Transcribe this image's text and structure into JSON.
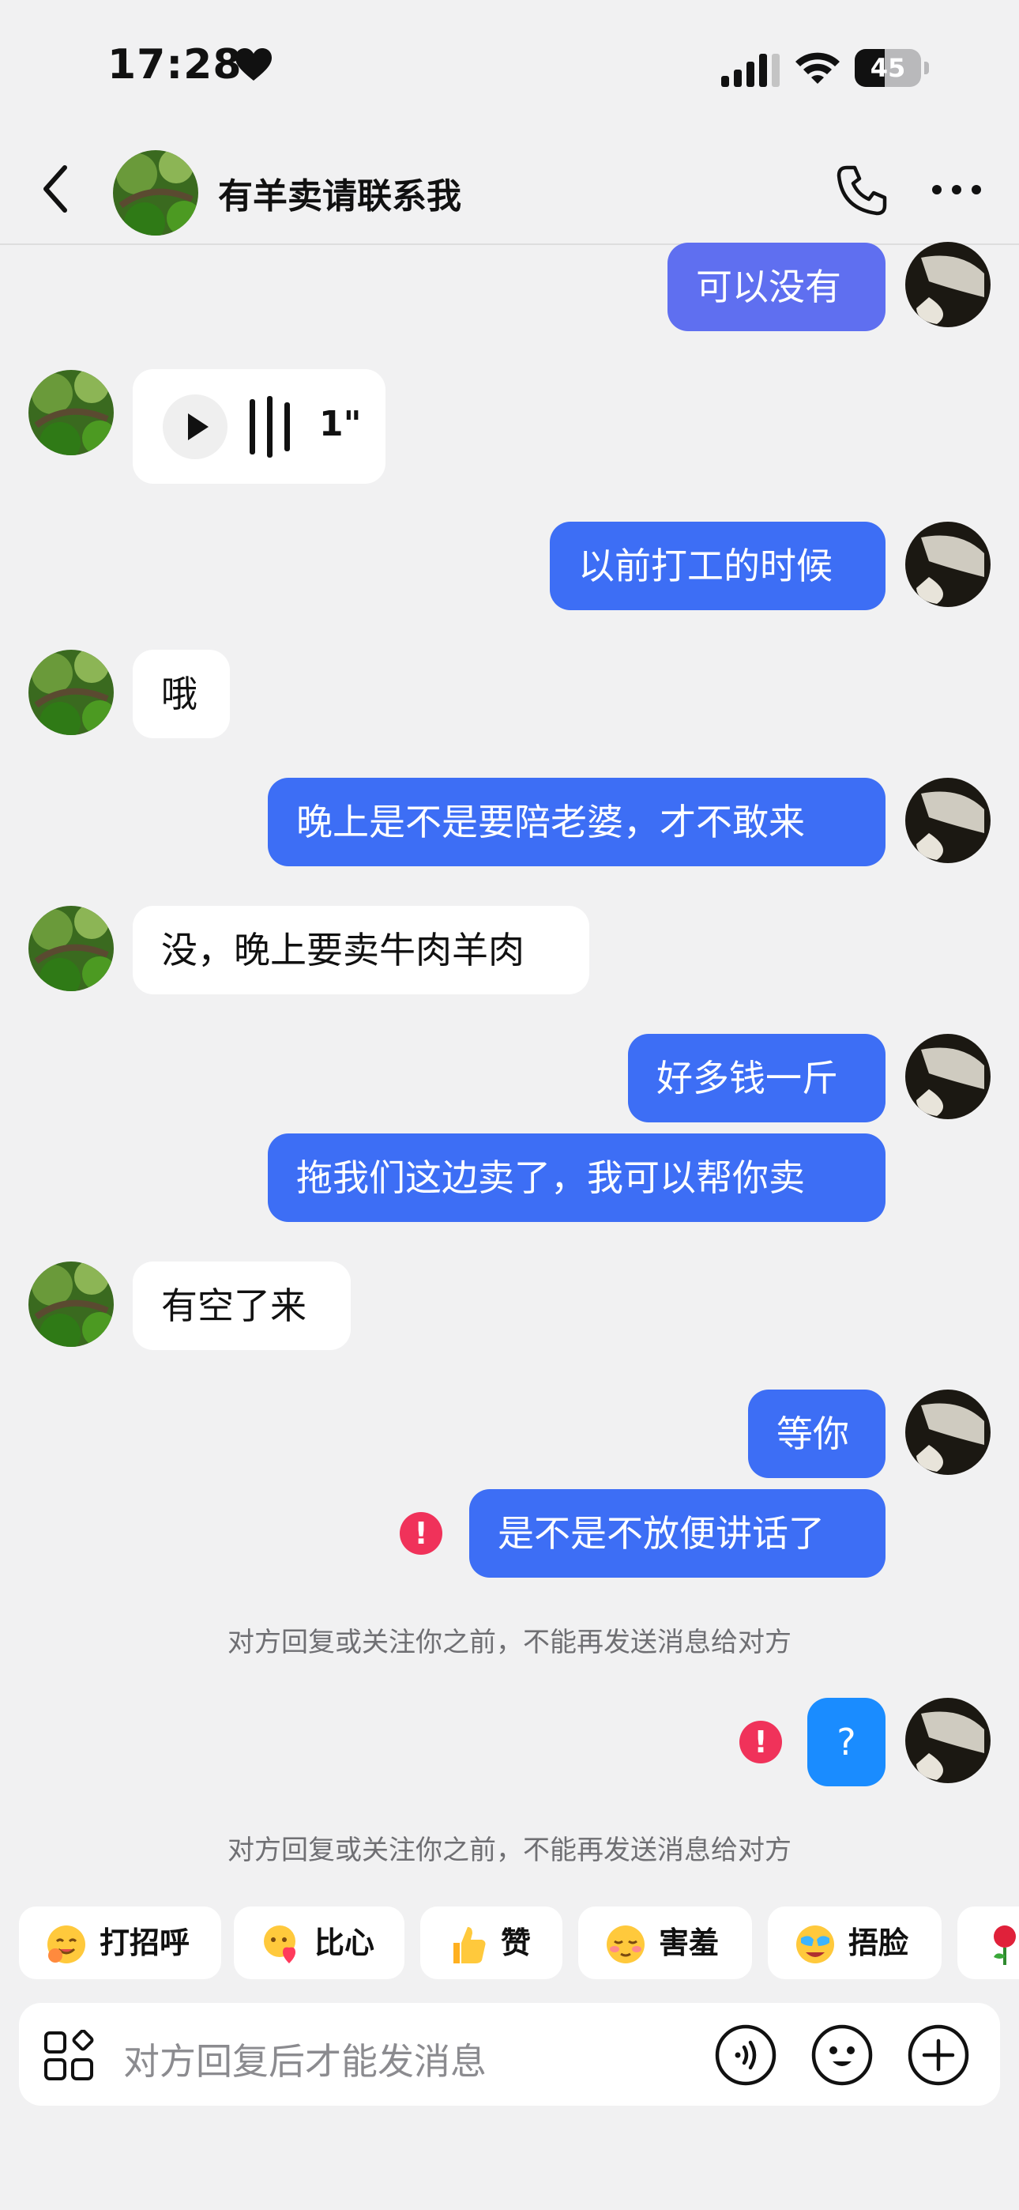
{
  "status_bar": {
    "time": "17:28",
    "battery": "45",
    "battery_level": 0.45
  },
  "header": {
    "title": "有羊卖请联系我"
  },
  "messages": {
    "m1": "可以没有",
    "voice_duration": "1\"",
    "m3": "以前打工的时候",
    "m4": "哦",
    "m5": "晚上是不是要陪老婆，才不敢来",
    "m6": "没，晚上要卖牛肉羊肉",
    "m7": "好多钱一斤",
    "m8": "拖我们这边卖了，我可以帮你卖",
    "m9": "有空了来",
    "m10": "等你",
    "m11": "是不是不放便讲话了",
    "m12": "?",
    "error_mark": "!"
  },
  "system_notice": "对方回复或关注你之前，不能再发送消息给对方",
  "quick_replies": [
    "打招呼",
    "比心",
    "赞",
    "害羞",
    "捂脸"
  ],
  "input": {
    "placeholder": "对方回复后才能发消息"
  },
  "colors": {
    "outgoing": "#3d6ef5",
    "outgoing_q": "#1a8cff",
    "error": "#f0325a",
    "background": "#f1f1f2"
  }
}
